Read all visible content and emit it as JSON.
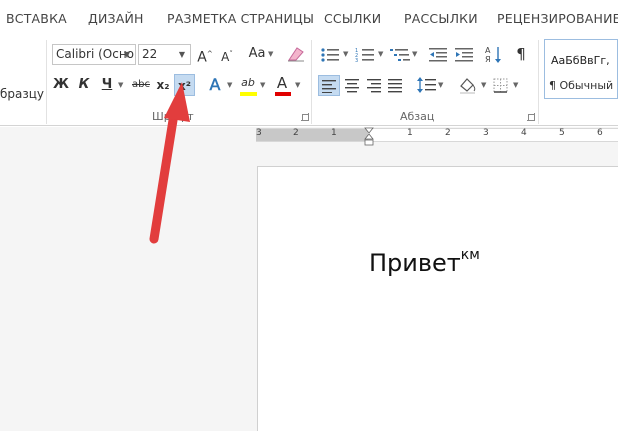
{
  "tabs": [
    "ВСТАВКА",
    "ДИЗАЙН",
    "РАЗМЕТКА СТРАНИЦЫ",
    "ССЫЛКИ",
    "РАССЫЛКИ",
    "РЕЦЕНЗИРОВАНИЕ"
  ],
  "clipboard": {
    "format_painter_label": "бразцу"
  },
  "font_group": {
    "label": "Шрифт",
    "font_name": "Calibri (Осно",
    "font_size": "22",
    "grow": "A",
    "shrink": "A",
    "change_case": "Aa",
    "bold": "Ж",
    "italic": "К",
    "underline": "Ч",
    "strikethrough": "abc",
    "subscript": "x₂",
    "superscript": "x²",
    "text_effects": "A",
    "highlight": "ab",
    "font_color": "A"
  },
  "paragraph_group": {
    "label": "Абзац",
    "show_marks": "¶"
  },
  "styles": {
    "preview": "АаБбВвГг,",
    "name": "¶ Обычный"
  },
  "ruler": {
    "numbers": [
      "3",
      "2",
      "1",
      "1",
      "2",
      "3",
      "4",
      "5",
      "6"
    ]
  },
  "document": {
    "text": "Привет",
    "superscript": "км"
  },
  "colors": {
    "highlight": "#ffff00",
    "font_color": "#e00000",
    "arrow": "#e23d3d",
    "selected": "#c5dbf1"
  }
}
